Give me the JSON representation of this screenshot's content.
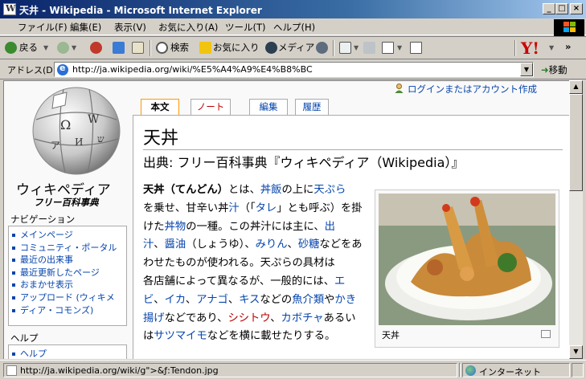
{
  "window": {
    "title": "天井 - Wikipedia - Microsoft Internet Explorer",
    "controls": {
      "minimize": "_",
      "maximize": "□",
      "close": "×"
    }
  },
  "menu": [
    "ファイル(F)",
    "編集(E)",
    "表示(V)",
    "お気に入り(A)",
    "ツール(T)",
    "ヘルプ(H)"
  ],
  "toolbar": {
    "back": "戻る",
    "search": "検索",
    "favorites": "お気に入り",
    "media": "メディア",
    "more": "»"
  },
  "address": {
    "label": "アドレス(D)",
    "url": "http://ja.wikipedia.org/wiki/%E5%A4%A9%E4%B8%BC",
    "go": "移動"
  },
  "wiki": {
    "logo_title": "ウィキペディア",
    "logo_subtitle": "フリー百科事典",
    "login": "ログインまたはアカウント作成",
    "tabs": [
      "本文",
      "ノート",
      "編集",
      "履歴"
    ],
    "nav_heading": "ナビゲーション",
    "nav_items": [
      "メインページ",
      "コミュニティ・ポータル",
      "最近の出来事",
      "最近更新したページ",
      "おまかせ表示",
      "アップロード (ウィキメ",
      "ディア・コモンズ)"
    ],
    "help_heading": "ヘルプ",
    "help_items": [
      "ヘルプ"
    ]
  },
  "article": {
    "title": "天丼",
    "from": "出典: フリー百科事典『ウィキペディア（Wikipedia）』",
    "lines": [
      [
        {
          "t": "天丼（てんどん）",
          "b": true
        },
        {
          "t": "とは、"
        },
        {
          "t": "丼",
          "l": "blue"
        },
        {
          "t": "飯",
          "l": "blue"
        },
        {
          "t": "の上に"
        },
        {
          "t": "天ぷら",
          "l": "blue"
        }
      ],
      [
        {
          "t": "を乗せ、甘辛い丼"
        },
        {
          "t": "汁",
          "l": "blue"
        },
        {
          "t": "（「"
        },
        {
          "t": "タレ",
          "l": "blue"
        },
        {
          "t": "」とも呼ぶ）を掛"
        }
      ],
      [
        {
          "t": "けた"
        },
        {
          "t": "丼物",
          "l": "blue"
        },
        {
          "t": "の一種。この丼汁には主に、"
        },
        {
          "t": "出",
          "l": "blue"
        }
      ],
      [
        {
          "t": "汁",
          "l": "blue"
        },
        {
          "t": "、"
        },
        {
          "t": "醤油",
          "l": "blue"
        },
        {
          "t": "（しょうゆ）、"
        },
        {
          "t": "みりん",
          "l": "blue"
        },
        {
          "t": "、"
        },
        {
          "t": "砂糖",
          "l": "blue"
        },
        {
          "t": "などをあ"
        }
      ],
      [
        {
          "t": "わせたものが使われる。天ぷらの具材は"
        }
      ],
      [
        {
          "t": "各店舗によって異なるが、一般的には、"
        },
        {
          "t": "エ",
          "l": "blue"
        }
      ],
      [
        {
          "t": "ビ",
          "l": "blue"
        },
        {
          "t": "、"
        },
        {
          "t": "イカ",
          "l": "blue"
        },
        {
          "t": "、"
        },
        {
          "t": "アナゴ",
          "l": "blue"
        },
        {
          "t": "、"
        },
        {
          "t": "キス",
          "l": "blue"
        },
        {
          "t": "などの"
        },
        {
          "t": "魚介類",
          "l": "blue"
        },
        {
          "t": "や"
        },
        {
          "t": "かき",
          "l": "blue"
        }
      ],
      [
        {
          "t": "揚げ",
          "l": "blue"
        },
        {
          "t": "などであり、"
        },
        {
          "t": "シシトウ",
          "l": "red"
        },
        {
          "t": "、"
        },
        {
          "t": "カボチャ",
          "l": "blue"
        },
        {
          "t": "あるい"
        }
      ],
      [
        {
          "t": "は"
        },
        {
          "t": "サツマイモ",
          "l": "blue"
        },
        {
          "t": "などを横に載せたりする。"
        }
      ]
    ],
    "image_caption": "天丼"
  },
  "status": {
    "text": "http://ja.wikipedia.org/wiki/g\">&ƒ:Tendon.jpg",
    "zone": "インターネット"
  }
}
